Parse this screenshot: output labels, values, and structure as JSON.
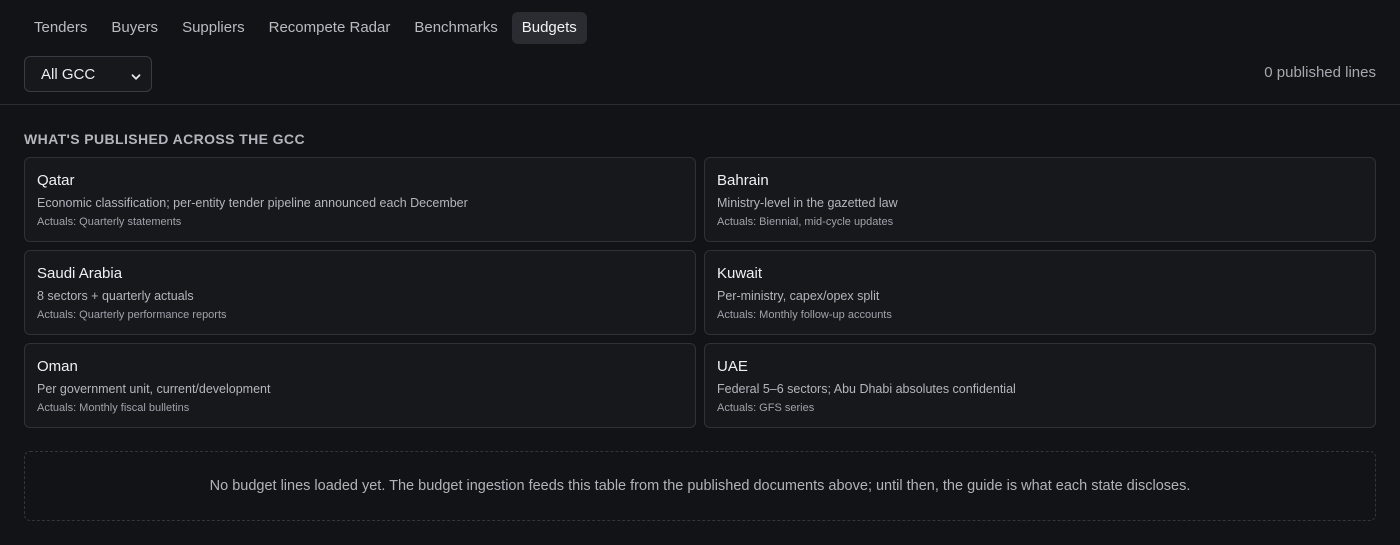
{
  "nav": {
    "tabs": [
      {
        "label": "Tenders"
      },
      {
        "label": "Buyers"
      },
      {
        "label": "Suppliers"
      },
      {
        "label": "Recompete Radar"
      },
      {
        "label": "Benchmarks"
      },
      {
        "label": "Budgets",
        "active": true
      }
    ]
  },
  "filter": {
    "selected": "All GCC"
  },
  "summary": {
    "published_count": "0 published lines"
  },
  "section": {
    "title": "WHAT'S PUBLISHED ACROSS THE GCC"
  },
  "countries": [
    {
      "name": "Qatar",
      "desc": "Economic classification; per-entity tender pipeline announced each December",
      "actuals": "Actuals: Quarterly statements"
    },
    {
      "name": "Bahrain",
      "desc": "Ministry-level in the gazetted law",
      "actuals": "Actuals: Biennial, mid-cycle updates"
    },
    {
      "name": "Saudi Arabia",
      "desc": "8 sectors + quarterly actuals",
      "actuals": "Actuals: Quarterly performance reports"
    },
    {
      "name": "Kuwait",
      "desc": "Per-ministry, capex/opex split",
      "actuals": "Actuals: Monthly follow-up accounts"
    },
    {
      "name": "Oman",
      "desc": "Per government unit, current/development",
      "actuals": "Actuals: Monthly fiscal bulletins"
    },
    {
      "name": "UAE",
      "desc": "Federal 5–6 sectors; Abu Dhabi absolutes confidential",
      "actuals": "Actuals: GFS series"
    }
  ],
  "empty_state": {
    "message": "No budget lines loaded yet. The budget ingestion feeds this table from the published documents above; until then, the guide is what each state discloses."
  },
  "colors": {
    "background": "#121316",
    "card": "#17181c",
    "active_tab": "#2a2c31"
  }
}
